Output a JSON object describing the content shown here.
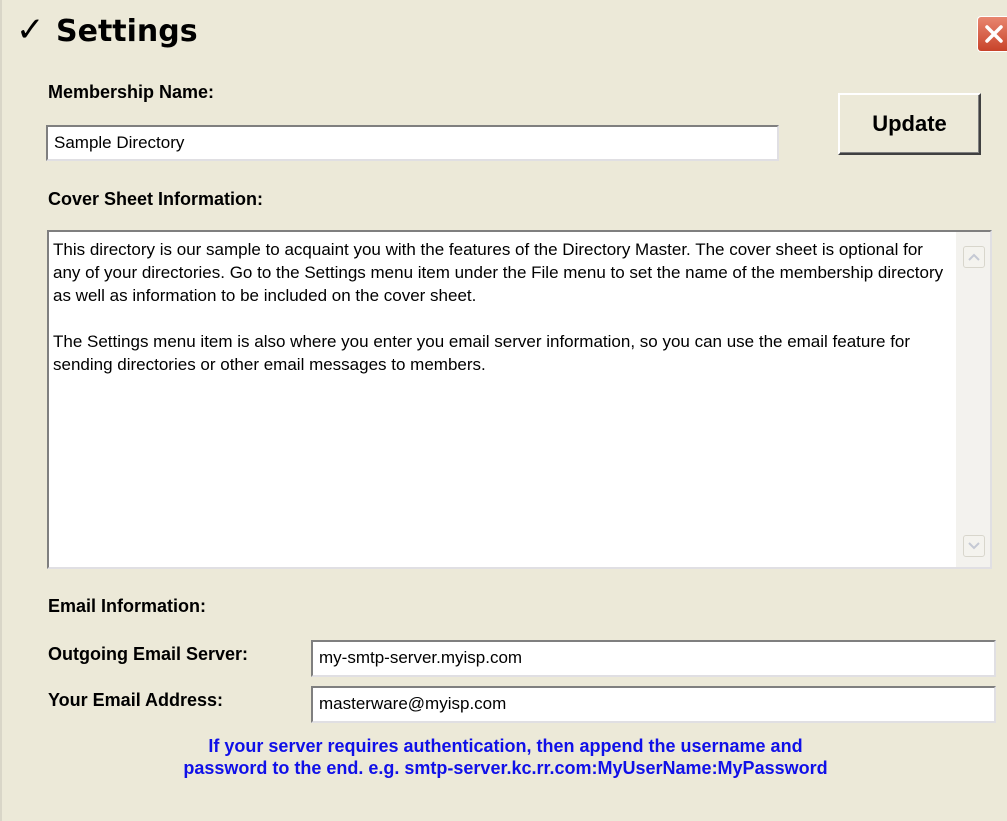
{
  "window": {
    "title": "Settings",
    "title_check": "✓",
    "close_icon": "close-icon"
  },
  "membership": {
    "label": "Membership Name:",
    "value": "Sample Directory"
  },
  "update_button": {
    "label": "Update"
  },
  "cover_sheet": {
    "label": "Cover Sheet Information:",
    "paragraphs": [
      "This directory is our sample to acquaint you with the features of the Directory Master.  The cover sheet is optional for any of your directories.  Go to the Settings menu item under the File menu to set the name of the membership directory as well as information to be included on the cover sheet.",
      "The Settings menu item is also where you enter you email server information, so you can use the email feature for sending directories or other email messages to members."
    ]
  },
  "email": {
    "section_label": "Email Information:",
    "server_label": "Outgoing Email Server:",
    "server_value": "my-smtp-server.myisp.com",
    "address_label": "Your Email Address:",
    "address_value": "masterware@myisp.com",
    "hint_line1": "If your server requires authentication, then append the username and",
    "hint_line2": "password to the end.  e.g. smtp-server.kc.rr.com:MyUserName:MyPassword"
  },
  "colors": {
    "window_bg": "#ece9d8",
    "hint_text": "#1010e8",
    "close_button": "#c8432a"
  }
}
